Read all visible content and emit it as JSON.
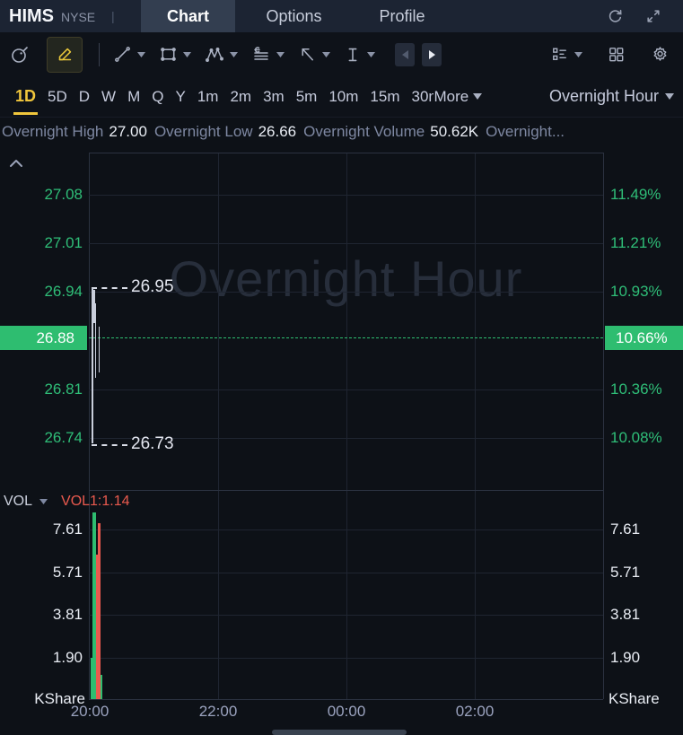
{
  "header": {
    "symbol": "HIMS",
    "exchange": "NYSE",
    "divider": "|",
    "tabs": [
      {
        "label": "Chart",
        "active": true
      },
      {
        "label": "Options",
        "active": false
      },
      {
        "label": "Profile",
        "active": false
      }
    ],
    "icons": [
      "refresh-icon",
      "fullscreen-icon"
    ]
  },
  "toolbar": {
    "icons": [
      "screener-gauge-icon",
      "draw-pencil-icon",
      "trend-line-icon",
      "rectangle-tool-icon",
      "wave-tool-icon",
      "annotation-lines-icon",
      "arrow-tool-icon",
      "text-tool-icon",
      "prev-drawing-icon",
      "next-drawing-icon",
      "object-list-icon",
      "multi-chart-icon",
      "settings-gear-icon"
    ],
    "active_tool": "draw-pencil"
  },
  "timeframe_bar": {
    "items": [
      "1D",
      "5D",
      "D",
      "W",
      "M",
      "Q",
      "Y",
      "1m",
      "2m",
      "3m",
      "5m",
      "10m",
      "15m",
      "30m"
    ],
    "active": "1D",
    "more_label": "More",
    "interval_label": "Overnight Hour"
  },
  "info_bar": {
    "parts": [
      {
        "label": "Overnight High",
        "value": "27.00"
      },
      {
        "label": "Overnight Low",
        "value": "26.66"
      },
      {
        "label": "Overnight Volume",
        "value": "50.62K"
      },
      {
        "label": "Overnight...",
        "value": ""
      }
    ]
  },
  "colors": {
    "up": "#2ebd70",
    "down": "#ea5a4e",
    "accent_yellow": "#f0c63c",
    "badge_green": "#2ebd70"
  },
  "chart_data": {
    "type": "candlestick",
    "watermark": "Overnight Hour",
    "x_ticks": [
      "20:00",
      "22:00",
      "00:00",
      "02:00"
    ],
    "price_pane": {
      "left_ticks": [
        "27.08",
        "27.01",
        "26.94",
        "26.81",
        "26.74"
      ],
      "right_ticks": [
        "11.49%",
        "11.21%",
        "10.93%",
        "10.36%",
        "10.08%"
      ],
      "last_price": "26.88",
      "last_change_pct": "10.66%",
      "high_annotation": "26.95",
      "low_annotation": "26.73",
      "wicks": [
        {
          "x_offset": 3,
          "high": 26.95,
          "low": 26.732
        },
        {
          "x_offset": 5,
          "high": 26.947,
          "low": 26.9
        },
        {
          "x_offset": 6.5,
          "high": 26.928,
          "low": 26.824
        },
        {
          "x_offset": 10.5,
          "high": 26.896,
          "low": 26.832
        }
      ]
    },
    "volume_pane": {
      "label": "VOL",
      "indicator_value": "VOL1:1.14",
      "ticks": [
        "7.61",
        "5.71",
        "3.81",
        "1.90"
      ],
      "unit_label": "KShare",
      "bars": [
        {
          "x_offset": 1.5,
          "width": 2,
          "value": 1.9,
          "dir": "up"
        },
        {
          "x_offset": 6,
          "width": 4.5,
          "value": 2.85,
          "dir": "down"
        },
        {
          "x_offset": 3.5,
          "width": 4,
          "value": 8.35,
          "dir": "up"
        },
        {
          "x_offset": 7.5,
          "width": 2,
          "value": 6.5,
          "dir": "down"
        },
        {
          "x_offset": 9.5,
          "width": 3,
          "value": 7.9,
          "dir": "down"
        },
        {
          "x_offset": 12.5,
          "width": 2.5,
          "value": 1.15,
          "dir": "up"
        }
      ]
    }
  }
}
